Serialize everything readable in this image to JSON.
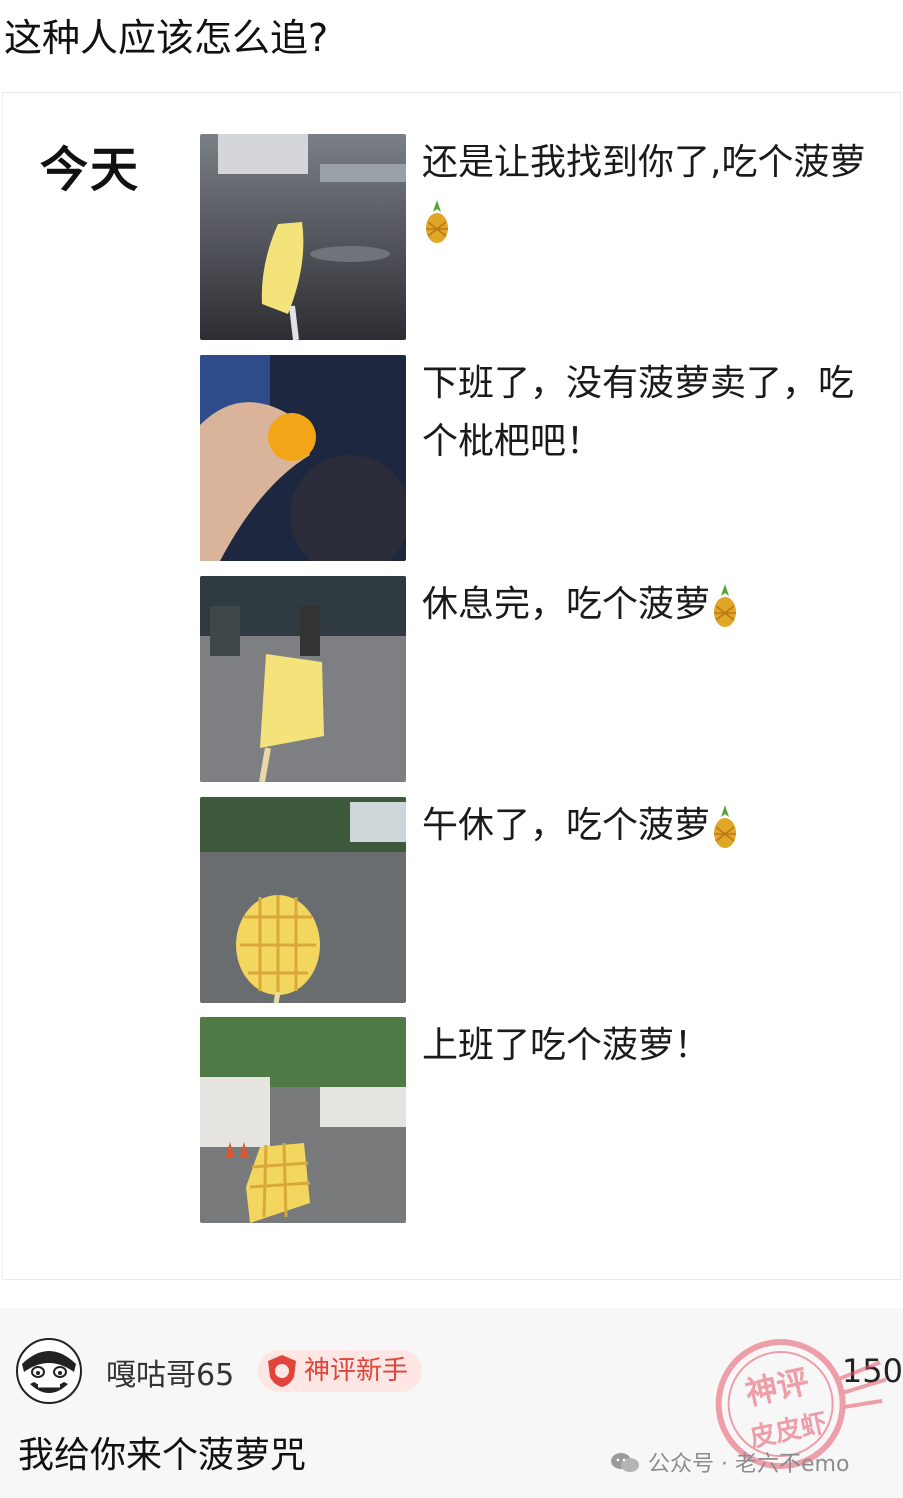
{
  "question": "这种人应该怎么追?",
  "post": {
    "day_label": "今天",
    "rows": [
      {
        "caption_line1": "还是让我找到你了,吃个菠萝",
        "caption_line2": "",
        "pineapple": "pineapple-emoji-line2"
      },
      {
        "caption_line1": "下班了，没有菠萝卖了，吃",
        "caption_line2": "个枇杷吧！",
        "pineapple": ""
      },
      {
        "caption_line1": "休息完，吃个菠萝",
        "caption_line2": "",
        "pineapple": "pineapple-emoji-inline"
      },
      {
        "caption_line1": "午休了，吃个菠萝",
        "caption_line2": "",
        "pineapple": "pineapple-emoji-inline"
      },
      {
        "caption_line1": "上班了吃个菠萝！",
        "caption_line2": "",
        "pineapple": ""
      }
    ]
  },
  "comment": {
    "username": "嘎咕哥65",
    "badge": "神评新手",
    "text": "我给你来个菠萝咒",
    "likes": "150"
  },
  "stamp": {
    "top": "神评",
    "bottom": "皮皮虾"
  },
  "watermark": "公众号 · 老六不emo",
  "colors": {
    "badge_text": "#e0443a",
    "badge_bg": "#fde6e3",
    "stamp": "#e8576a"
  }
}
